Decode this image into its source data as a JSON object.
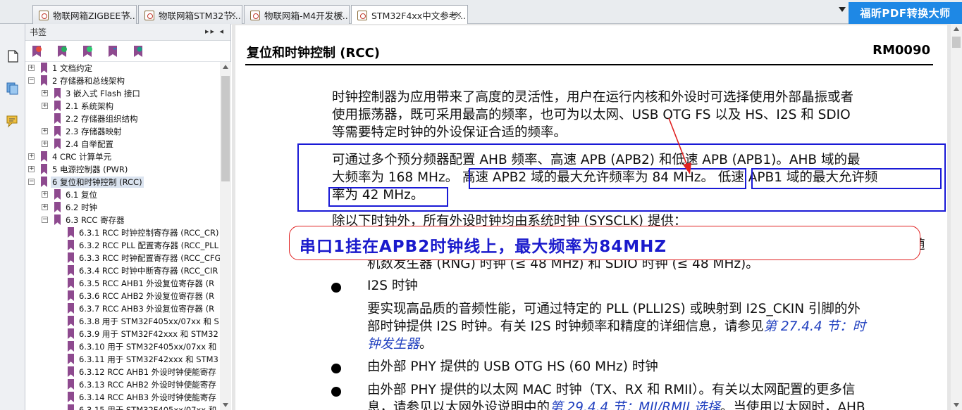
{
  "tabs": [
    {
      "label": "物联网箱ZIGBEE节...",
      "close": "×"
    },
    {
      "label": "物联网箱STM32节...",
      "close": "×"
    },
    {
      "label": "物联网箱-M4开发板...",
      "close": "×"
    },
    {
      "label": "STM32F4xx中文参考...",
      "close": "×"
    }
  ],
  "brand": "福昕PDF转换大师",
  "panel": {
    "title": "书签",
    "head_buttons": "▸▸ ◂",
    "tree": [
      {
        "label": "1 文档约定",
        "expander": "+"
      },
      {
        "label": "2 存储器和总线架构",
        "expander": "−"
      },
      {
        "label": "3 嵌入式 Flash 接口",
        "expander": "+"
      },
      {
        "label": "2.1 系统架构",
        "expander": "+"
      },
      {
        "label": "2.2 存储器组织结构",
        "expander": ""
      },
      {
        "label": "2.3 存储器映射",
        "expander": "+"
      },
      {
        "label": "2.4 自举配置",
        "expander": "+"
      },
      {
        "label": "4 CRC 计算单元",
        "expander": "+"
      },
      {
        "label": "5 电源控制器 (PWR)",
        "expander": "+"
      },
      {
        "label": "6 复位和时钟控制 (RCC)",
        "expander": "−"
      },
      {
        "label": "6.1 复位",
        "expander": "+"
      },
      {
        "label": "6.2 时钟",
        "expander": "+"
      },
      {
        "label": "6.3 RCC 寄存器",
        "expander": "−"
      },
      {
        "label": "6.3.1 RCC 时钟控制寄存器 (RCC_CR)",
        "expander": ""
      },
      {
        "label": "6.3.2 RCC PLL 配置寄存器 (RCC_PLL",
        "expander": ""
      },
      {
        "label": "6.3.3 RCC 时钟配置寄存器 (RCC_CFG",
        "expander": ""
      },
      {
        "label": "6.3.4 RCC 时钟中断寄存器 (RCC_CIR",
        "expander": ""
      },
      {
        "label": "6.3.5 RCC AHB1 外设复位寄存器 (R",
        "expander": ""
      },
      {
        "label": "6.3.6 RCC AHB2 外设复位寄存器 (R",
        "expander": ""
      },
      {
        "label": "6.3.7 RCC AHB3 外设复位寄存器 (R",
        "expander": ""
      },
      {
        "label": "6.3.8 用于 STM32F405xx/07xx 和 S",
        "expander": ""
      },
      {
        "label": "6.3.9 用于 STM32F42xxx 和 STM32",
        "expander": ""
      },
      {
        "label": "6.3.10 用于 STM32F405xx/07xx 和",
        "expander": ""
      },
      {
        "label": "6.3.11 用于 STM32F42xxx 和 STM3",
        "expander": ""
      },
      {
        "label": "6.3.12 RCC AHB1 外设时钟使能寄存",
        "expander": ""
      },
      {
        "label": "6.3.13 RCC AHB2 外设时钟使能寄存",
        "expander": ""
      },
      {
        "label": "6.3.14 RCC AHB3 外设时钟使能寄存",
        "expander": ""
      },
      {
        "label": "6.3.15 用于 STM32F405xx/07xx 和",
        "expander": ""
      }
    ]
  },
  "doc": {
    "title": "复位和时钟控制 (RCC)",
    "code": "RM0090",
    "para1": [
      "时钟控制器为应用带来了高度的灵活性，用户在运行内核和外设时可选择使用外部晶振或者",
      "使用振荡器，既可采用最高的频率，也可为以太网、USB OTG FS 以及 HS、I2S 和 SDIO",
      "等需要特定时钟的外设保证合适的频率。"
    ],
    "para2_line1": "可通过多个预分频器配置 AHB 频率、高速 APB (APB2) 和低速 APB (APB1)。AHB 域的最",
    "para2_line2a": "大频率为 168 MHz。",
    "para2_line2b": "高速 APB2 域的最大允许频率为 84 MHz。",
    "para2_line2c": "低速 APB1 域的最大允许频",
    "para2_line3": "率为 42 MHz。",
    "para3_partial": "除以下时钟外，所有外设时钟均由系统时钟 (SYSCLK) 提供：",
    "callout": "串口1挂在APB2时钟线上，最大频率为84MHZ",
    "trail_char": "随",
    "rng_line": "机数发生器 (RNG) 时钟 (≤ 48 MHz) 和 SDIO 时钟 (≤ 48 MHz)。",
    "i2s_title": "I2S 时钟",
    "i2s_line1": "要实现高品质的音频性能，可通过特定的 PLL (PLLI2S) 或映射到 I2S_CKIN 引脚的外",
    "i2s_line2a": "部时钟提供 I2S 时钟。有关 I2S 时钟频率和精度的详细信息，请参见",
    "i2s_link1": "第 27.4.4 节：时",
    "i2s_link2": "钟发生器",
    "i2s_line3end": "。",
    "phy_usb": "由外部 PHY 提供的 USB OTG HS (60 MHz) 时钟",
    "phy_mac": "由外部 PHY 提供的以太网 MAC 时钟（TX、RX 和 RMII）。有关以太网配置的更多信",
    "phy_mac2a": "息，请参见以太网外设说明中的",
    "phy_mac2link": "第 29.4.4 节：MII/RMII 选择",
    "phy_mac2b": "。当使用以太网时，AHB"
  },
  "colors": {
    "accent": "#1e88e5",
    "annotation_blue": "#1a1ad6",
    "annotation_red": "#e02020",
    "bookmark": "#8e4a8f"
  }
}
